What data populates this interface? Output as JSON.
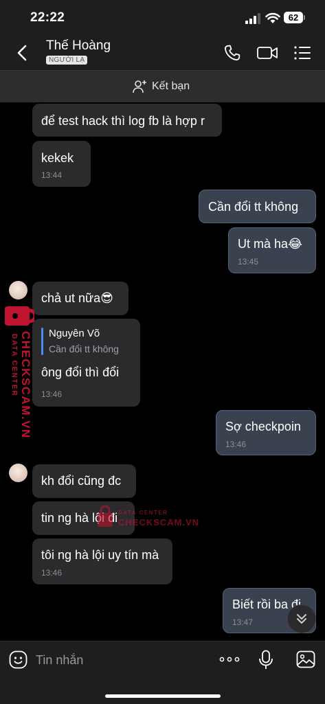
{
  "status_bar": {
    "time": "22:22",
    "battery": "62"
  },
  "header": {
    "contact_name": "Thế Hoàng",
    "badge": "NGƯỜI LẠ"
  },
  "add_friend": {
    "label": "Kết bạn"
  },
  "messages": [
    {
      "side": "in",
      "text": "để test hack thì log fb là hợp r"
    },
    {
      "side": "in",
      "text": "kekek",
      "time": "13:44"
    },
    {
      "side": "out",
      "text": "Cần đổi tt không"
    },
    {
      "side": "out",
      "text": "Ut mà ha😂",
      "time": "13:45"
    },
    {
      "side": "in",
      "text": "chả ut nữa😎"
    },
    {
      "side": "in",
      "reply_name": "Nguyên Võ",
      "reply_text": "Cần đổi tt không",
      "text": "ông đổi thì đổi",
      "time": "13:46"
    },
    {
      "side": "out",
      "text": "Sợ checkpoin",
      "time": "13:46"
    },
    {
      "side": "in",
      "text": "kh đổi cũng đc"
    },
    {
      "side": "in",
      "text": "tin ng hà lội đi"
    },
    {
      "side": "in",
      "text": "tôi ng hà lội uy tín mà",
      "time": "13:46"
    },
    {
      "side": "out",
      "text": "Biết rồi ba đi",
      "time": "13:47"
    }
  ],
  "watermark": {
    "line1": "DATA CENTER",
    "line2": "CHECKSCAM.VN"
  },
  "input": {
    "placeholder": "Tin nhắn"
  },
  "colors": {
    "incoming_bubble": "#2b2b2d",
    "outgoing_bubble": "#3a4250",
    "background": "#000000",
    "bar": "#1e1e1e",
    "watermark": "#c0132f"
  },
  "icons": [
    "back-icon",
    "phone-icon",
    "video-call-icon",
    "menu-list-icon",
    "add-user-icon",
    "chevron-double-down-icon",
    "emoji-icon",
    "more-icon",
    "microphone-icon",
    "image-icon"
  ]
}
